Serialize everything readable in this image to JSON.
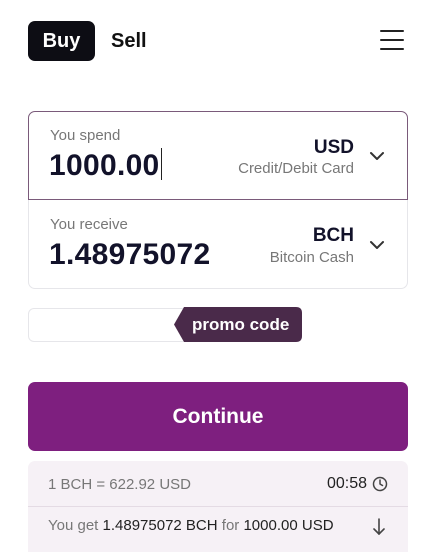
{
  "header": {
    "buy_label": "Buy",
    "sell_label": "Sell",
    "menu_icon": "hamburger-menu-icon"
  },
  "spend": {
    "label": "You spend",
    "amount": "1000.00",
    "currency": "USD",
    "method": "Credit/Debit Card",
    "dropdown_icon": "chevron-down-icon"
  },
  "receive": {
    "label": "You receive",
    "amount": "1.48975072",
    "currency": "BCH",
    "currency_name": "Bitcoin Cash",
    "dropdown_icon": "chevron-down-icon"
  },
  "promo": {
    "input_value": "",
    "tag_label": "promo code"
  },
  "actions": {
    "continue_label": "Continue"
  },
  "quote": {
    "rate": "1 BCH = 622.92 USD",
    "timer": "00:58",
    "timer_icon": "clock-icon",
    "get_prefix": "You get",
    "get_amount": "1.48975072 BCH",
    "get_for": "for",
    "get_total": "1000.00 USD",
    "expand_icon": "arrow-down-icon"
  },
  "colors": {
    "primary": "#7e1f7f",
    "promo_tag": "#4a2a4a",
    "buy_tab": "#0d0d14",
    "quote_bg": "#f6f1f6"
  }
}
